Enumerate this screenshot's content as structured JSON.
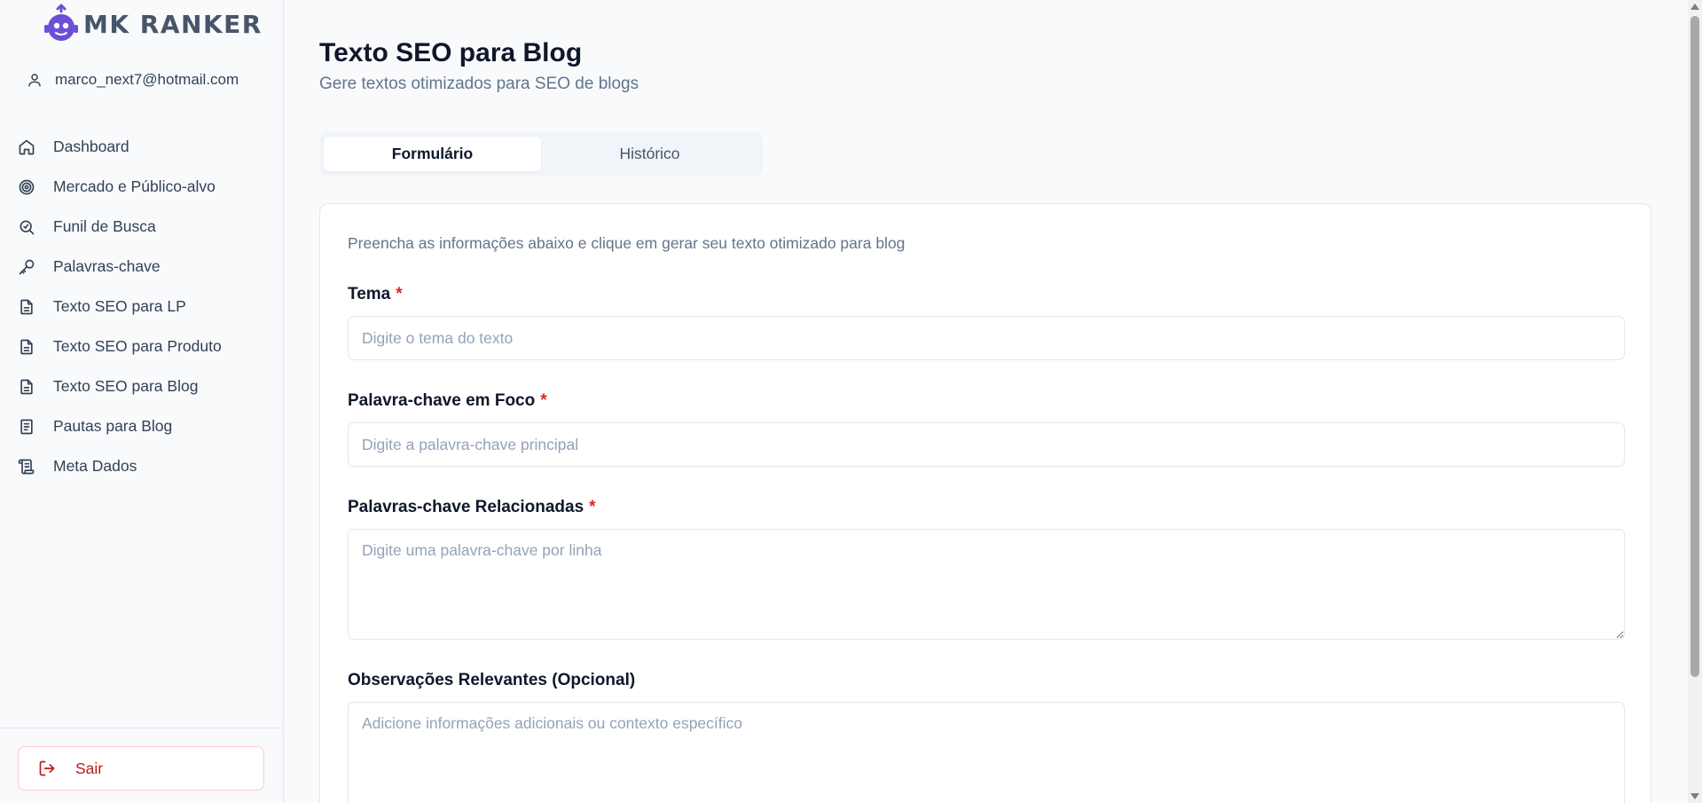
{
  "app": {
    "logo_text": "MK RANKER",
    "user_email": "marco_next7@hotmail.com"
  },
  "sidebar": {
    "items": [
      {
        "label": "Dashboard",
        "icon": "home-icon"
      },
      {
        "label": "Mercado e Público-alvo",
        "icon": "target-icon"
      },
      {
        "label": "Funil de Busca",
        "icon": "search-icon"
      },
      {
        "label": "Palavras-chave",
        "icon": "key-icon"
      },
      {
        "label": "Texto SEO para LP",
        "icon": "file-text-icon"
      },
      {
        "label": "Texto SEO para Produto",
        "icon": "file-text-icon"
      },
      {
        "label": "Texto SEO para Blog",
        "icon": "file-text-icon"
      },
      {
        "label": "Pautas para Blog",
        "icon": "notebook-icon"
      },
      {
        "label": "Meta Dados",
        "icon": "scroll-icon"
      }
    ],
    "logout_label": "Sair"
  },
  "page": {
    "title": "Texto SEO para Blog",
    "subtitle": "Gere textos otimizados para SEO de blogs"
  },
  "tabs": [
    {
      "label": "Formulário",
      "active": true
    },
    {
      "label": "Histórico",
      "active": false
    }
  ],
  "form": {
    "intro": "Preencha as informações abaixo e clique em gerar seu texto otimizado para blog",
    "required_mark": "*",
    "fields": {
      "tema": {
        "label": "Tema",
        "placeholder": "Digite o tema do texto",
        "value": ""
      },
      "palavra_chave": {
        "label": "Palavra-chave em Foco",
        "placeholder": "Digite a palavra-chave principal",
        "value": ""
      },
      "relacionadas": {
        "label": "Palavras-chave Relacionadas",
        "placeholder": "Digite uma palavra-chave por linha",
        "value": ""
      },
      "observacoes": {
        "label": "Observações Relevantes (Opcional)",
        "placeholder": "Adicione informações adicionais ou contexto específico",
        "value": ""
      }
    }
  },
  "colors": {
    "accent": "#6d4ed6",
    "danger": "#dc2626",
    "background": "#f8fafc"
  }
}
